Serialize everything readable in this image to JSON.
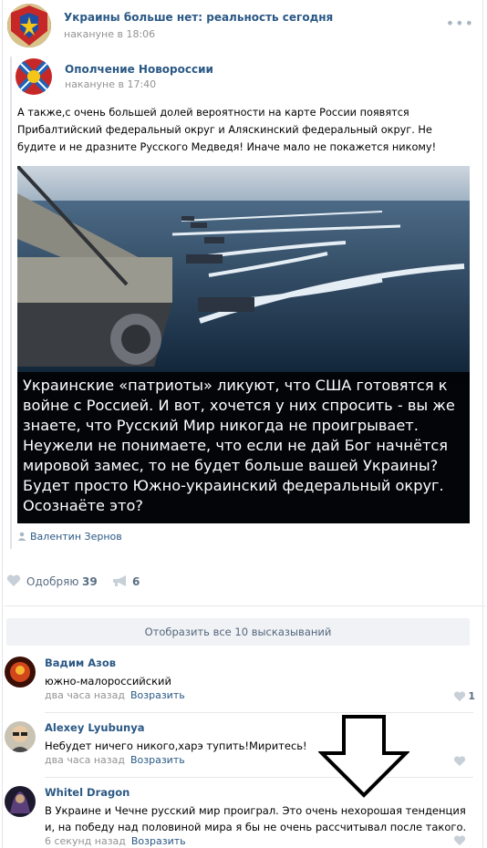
{
  "post": {
    "author": "Украины больше нет: реальность сегодня",
    "time": "накануне в 18:06",
    "more": "•••"
  },
  "repost": {
    "author": "Ополчение Новороссии",
    "time": "накануне в 17:40",
    "text": "А также,с очень большей долей вероятности на карте России появятся Прибалтийский федеральный округ и Аляскинский федеральный округ. Не будите и не дразните Русского Медведя! Иначе мало не покажется никому!",
    "image_caption": "Украинские «патриоты» ликуют, что США готовятся к войне с Россией. И вот, хочется у них спросить - вы же знаете, что Русский Мир никогда не проигрывает. Неужели не понимаете, что если не дай Бог начнётся мировой замес, то не будет больше вашей Украины? Будет просто Южно-украинский федеральный округ. Осознаёте это?",
    "signer": "Валентин Зернов"
  },
  "actions": {
    "like_label": "Одобряю",
    "like_count": "39",
    "share_count": "6"
  },
  "show_all": "Отобразить все 10 высказываний",
  "comments": [
    {
      "name": "Вадим Азов",
      "text": "южно-малороссийский",
      "time": "два часа назад",
      "reply": "Возразить",
      "likes": "1"
    },
    {
      "name": "Alexey Lyubunya",
      "text": "Небудет ничего никого,харэ тупить!Миритесь!",
      "time": "два часа назад",
      "reply": "Возразить",
      "likes": ""
    },
    {
      "name": "Whitel Dragon",
      "text": "В Украине и Чечне русский мир проиграл. Это очень нехорошая тенденция и, на победу над половиной мира я бы не очень рассчитывал после такого.",
      "time": "6 секунд назад",
      "reply": "Возразить",
      "likes": ""
    }
  ],
  "colors": {
    "link": "#2a5885",
    "muted": "#939393",
    "button_bg": "#f0f2f5"
  }
}
